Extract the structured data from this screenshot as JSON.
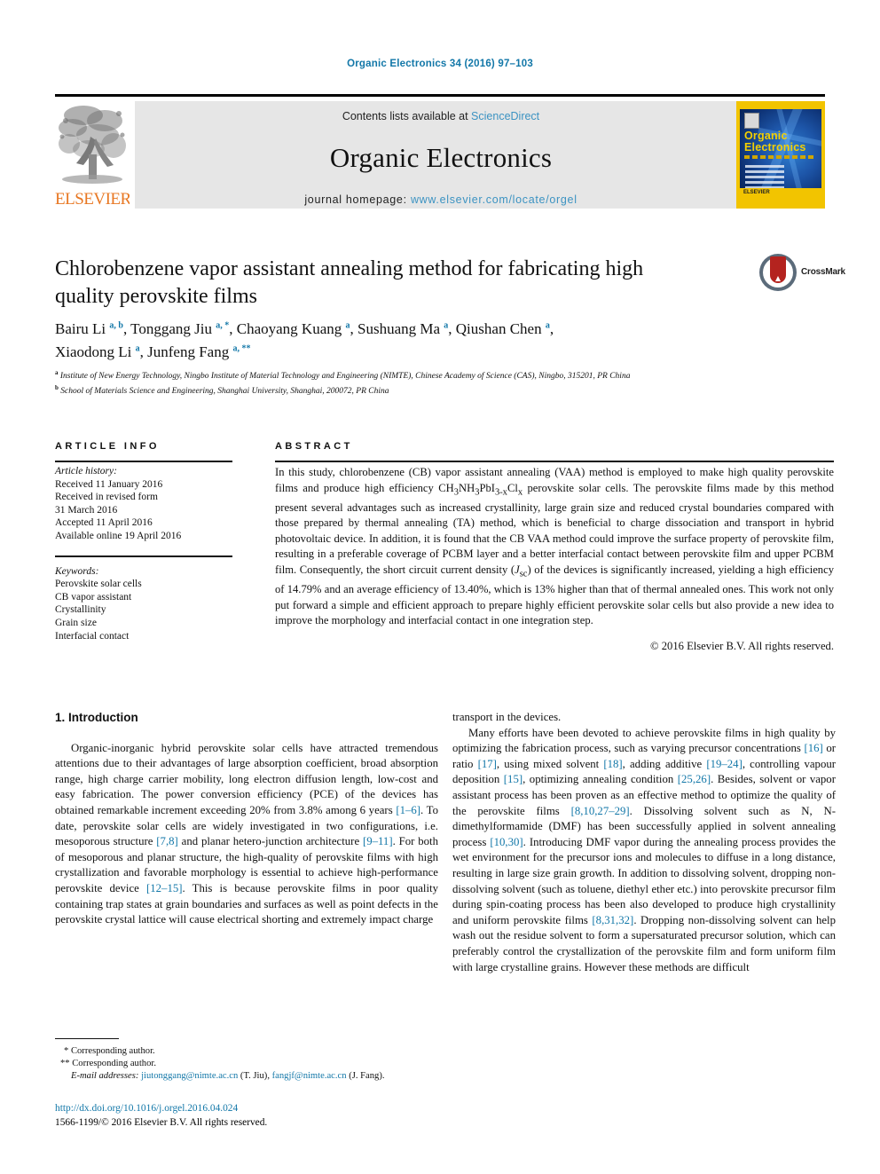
{
  "running_head": "Organic Electronics 34 (2016) 97–103",
  "banner": {
    "publisher_name": "ELSEVIER",
    "contents_prefix": "Contents lists available at ",
    "contents_link": "ScienceDirect",
    "journal_title": "Organic Electronics",
    "homepage_prefix": "journal homepage: ",
    "homepage_url": "www.elsevier.com/locate/orgel",
    "cover": {
      "line1": "Organic",
      "line2": "Electronics",
      "footer": "ELSEVIER"
    }
  },
  "article": {
    "title": "Chlorobenzene vapor assistant annealing method for fabricating high quality perovskite films",
    "crossmark_label": "CrossMark",
    "authors_line1": "Bairu Li a, b, Tonggang Jiu a, *, Chaoyang Kuang a, Sushuang Ma a, Qiushan Chen a,",
    "authors_line2": "Xiaodong Li a, Junfeng Fang a, **",
    "affiliation_a": "Institute of New Energy Technology, Ningbo Institute of Material Technology and Engineering (NIMTE), Chinese Academy of Science (CAS), Ningbo, 315201, PR China",
    "affiliation_b": "School of Materials Science and Engineering, Shanghai University, Shanghai, 200072, PR China"
  },
  "article_info": {
    "heading": "ARTICLE INFO",
    "history_label": "Article history:",
    "history": [
      "Received 11 January 2016",
      "Received in revised form",
      "31 March 2016",
      "Accepted 11 April 2016",
      "Available online 19 April 2016"
    ],
    "keywords_label": "Keywords:",
    "keywords": [
      "Perovskite solar cells",
      "CB vapor assistant",
      "Crystallinity",
      "Grain size",
      "Interfacial contact"
    ]
  },
  "abstract": {
    "heading": "ABSTRACT",
    "text": "In this study, chlorobenzene (CB) vapor assistant annealing (VAA) method is employed to make high quality perovskite films and produce high efficiency CH3NH3PbI3-xClx perovskite solar cells. The perovskite films made by this method present several advantages such as increased crystallinity, large grain size and reduced crystal boundaries compared with those prepared by thermal annealing (TA) method, which is beneficial to charge dissociation and transport in hybrid photovoltaic device. In addition, it is found that the CB VAA method could improve the surface property of perovskite film, resulting in a preferable coverage of PCBM layer and a better interfacial contact between perovskite film and upper PCBM film. Consequently, the short circuit current density (Jsc) of the devices is significantly increased, yielding a high efficiency of 14.79% and an average efficiency of 13.40%, which is 13% higher than that of thermal annealed ones. This work not only put forward a simple and efficient approach to prepare highly efficient perovskite solar cells but also provide a new idea to improve the morphology and interfacial contact in one integration step.",
    "copyright": "© 2016 Elsevier B.V. All rights reserved."
  },
  "body": {
    "section_heading": "1. Introduction",
    "left_p1": "Organic-inorganic hybrid perovskite solar cells have attracted tremendous attentions due to their advantages of large absorption coefficient, broad absorption range, high charge carrier mobility, long electron diffusion length, low-cost and easy fabrication. The power conversion efficiency (PCE) of the devices has obtained remarkable increment exceeding 20% from 3.8% among 6 years [1–6]. To date, perovskite solar cells are widely investigated in two configurations, i.e. mesoporous structure [7,8] and planar hetero-junction architecture [9–11]. For both of mesoporous and planar structure, the high-quality of perovskite films with high crystallization and favorable morphology is essential to achieve high-performance perovskite device [12–15]. This is because perovskite films in poor quality containing trap states at grain boundaries and surfaces as well as point defects in the perovskite crystal lattice will cause electrical shorting and extremely impact charge",
    "right_p1": "transport in the devices.",
    "right_p2": "Many efforts have been devoted to achieve perovskite films in high quality by optimizing the fabrication process, such as varying precursor concentrations [16] or ratio [17], using mixed solvent [18], adding additive [19–24], controlling vapour deposition [15], optimizing annealing condition [25,26]. Besides, solvent or vapor assistant process has been proven as an effective method to optimize the quality of the perovskite films [8,10,27–29]. Dissolving solvent such as N, N-dimethylformamide (DMF) has been successfully applied in solvent annealing process [10,30]. Introducing DMF vapor during the annealing process provides the wet environment for the precursor ions and molecules to diffuse in a long distance, resulting in large size grain growth. In addition to dissolving solvent, dropping non-dissolving solvent (such as toluene, diethyl ether etc.) into perovskite precursor film during spin-coating process has been also developed to produce high crystallinity and uniform perovskite films [8,31,32]. Dropping non-dissolving solvent can help wash out the residue solvent to form a supersaturated precursor solution, which can preferably control the crystallization of the perovskite film and form uniform film with large crystalline grains. However these methods are difficult"
  },
  "footnotes": {
    "corresponding1": "* Corresponding author.",
    "corresponding2": "** Corresponding author.",
    "email_label": "E-mail addresses:",
    "email1": "jiutonggang@nimte.ac.cn",
    "email1_owner": "(T. Jiu),",
    "email2": "fangjf@nimte.ac.cn",
    "email2_owner": "(J. Fang).",
    "doi": "http://dx.doi.org/10.1016/j.orgel.2016.04.024",
    "issn_line": "1566-1199/© 2016 Elsevier B.V. All rights reserved."
  },
  "colors": {
    "link_blue": "#1277a8",
    "sciencedirect_blue": "#3c93c2",
    "elsevier_orange": "#e87722",
    "banner_grey": "#e6e6e6",
    "cover_yellow": "#f2c400",
    "crossmark_red": "#b4231f"
  }
}
